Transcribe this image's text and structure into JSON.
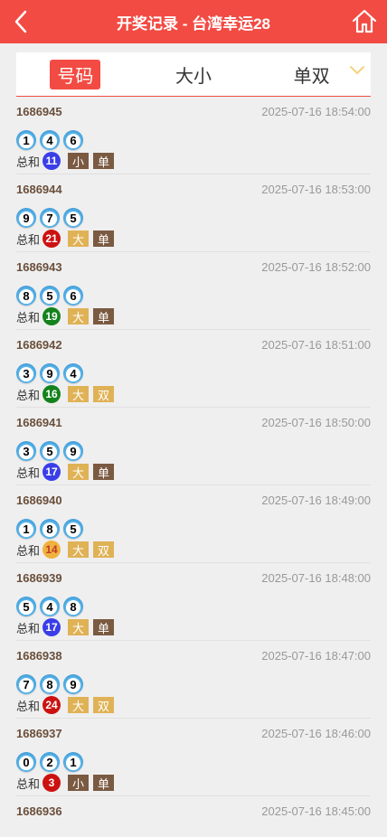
{
  "header": {
    "title": "开奖记录 - 台湾幸运28",
    "back_icon": "back-arrow-icon",
    "home_icon": "home-icon"
  },
  "tabs": [
    {
      "label": "号码",
      "active": true
    },
    {
      "label": "大小",
      "active": false
    },
    {
      "label": "单双",
      "active": false
    }
  ],
  "sum_label": "总和",
  "colors": {
    "accent": "#f24b43",
    "blue": "#3a3ee8",
    "red": "#cc1111",
    "green": "#14821c",
    "orange": "#f0b23e",
    "tag_gold": "#e0b256",
    "tag_brown": "#7b5a42"
  },
  "draws": [
    {
      "issue": "1686945",
      "time": "2025-07-16 18:54:00",
      "balls": [
        "1",
        "4",
        "6"
      ],
      "sum": "11",
      "sum_color": "#3a3ee8",
      "size": "小",
      "parity": "单"
    },
    {
      "issue": "1686944",
      "time": "2025-07-16 18:53:00",
      "balls": [
        "9",
        "7",
        "5"
      ],
      "sum": "21",
      "sum_color": "#cc1111",
      "size": "大",
      "parity": "单"
    },
    {
      "issue": "1686943",
      "time": "2025-07-16 18:52:00",
      "balls": [
        "8",
        "5",
        "6"
      ],
      "sum": "19",
      "sum_color": "#14821c",
      "size": "大",
      "parity": "单"
    },
    {
      "issue": "1686942",
      "time": "2025-07-16 18:51:00",
      "balls": [
        "3",
        "9",
        "4"
      ],
      "sum": "16",
      "sum_color": "#14821c",
      "size": "大",
      "parity": "双"
    },
    {
      "issue": "1686941",
      "time": "2025-07-16 18:50:00",
      "balls": [
        "3",
        "5",
        "9"
      ],
      "sum": "17",
      "sum_color": "#3a3ee8",
      "size": "大",
      "parity": "单"
    },
    {
      "issue": "1686940",
      "time": "2025-07-16 18:49:00",
      "balls": [
        "1",
        "8",
        "5"
      ],
      "sum": "14",
      "sum_color": "#f0b23e",
      "size": "大",
      "parity": "双"
    },
    {
      "issue": "1686939",
      "time": "2025-07-16 18:48:00",
      "balls": [
        "5",
        "4",
        "8"
      ],
      "sum": "17",
      "sum_color": "#3a3ee8",
      "size": "大",
      "parity": "单"
    },
    {
      "issue": "1686938",
      "time": "2025-07-16 18:47:00",
      "balls": [
        "7",
        "8",
        "9"
      ],
      "sum": "24",
      "sum_color": "#cc1111",
      "size": "大",
      "parity": "双"
    },
    {
      "issue": "1686937",
      "time": "2025-07-16 18:46:00",
      "balls": [
        "0",
        "2",
        "1"
      ],
      "sum": "3",
      "sum_color": "#cc1111",
      "size": "小",
      "parity": "单"
    },
    {
      "issue": "1686936",
      "time": "2025-07-16 18:45:00",
      "balls": [],
      "sum": null,
      "sum_color": null,
      "size": null,
      "parity": null
    }
  ]
}
